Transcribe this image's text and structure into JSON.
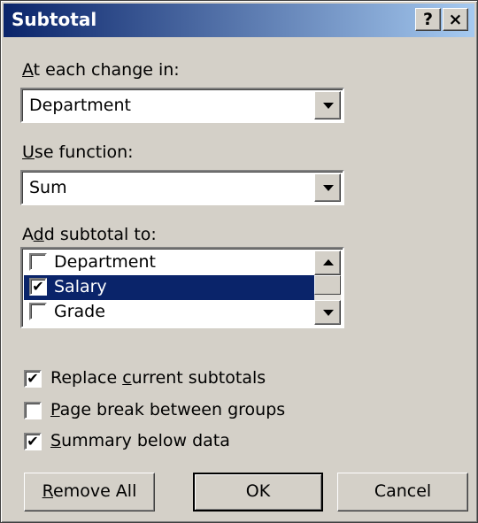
{
  "window": {
    "title": "Subtotal",
    "help_button": "?",
    "close_button": "×"
  },
  "at_each_change": {
    "label_prefix": "",
    "label_accel": "A",
    "label_rest": "t each change in:",
    "value": "Department"
  },
  "use_function": {
    "label_accel": "U",
    "label_rest": "se function:",
    "value": "Sum"
  },
  "add_subtotal": {
    "label_prefix": "A",
    "label_accel": "d",
    "label_rest": "d subtotal to:",
    "items": [
      {
        "label": "Department",
        "checked": false,
        "selected": false
      },
      {
        "label": "Salary",
        "checked": true,
        "selected": true
      },
      {
        "label": "Grade",
        "checked": false,
        "selected": false
      }
    ]
  },
  "options": {
    "replace": {
      "prefix": "Replace ",
      "accel": "c",
      "rest": "urrent subtotals",
      "checked": true
    },
    "page_break": {
      "prefix": "",
      "accel": "P",
      "rest": "age break between groups",
      "checked": false
    },
    "summary": {
      "prefix": "",
      "accel": "S",
      "rest": "ummary below data",
      "checked": true
    }
  },
  "buttons": {
    "remove_all_accel": "R",
    "remove_all_rest": "emove All",
    "ok": "OK",
    "cancel": "Cancel"
  },
  "check_mark": "✔"
}
